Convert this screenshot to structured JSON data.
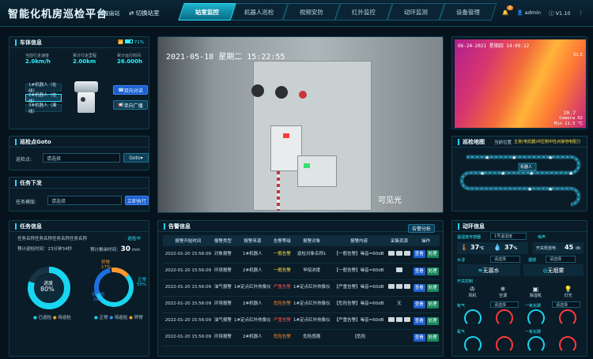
{
  "header": {
    "title": "智能化机房巡检平台",
    "site": "· 城隍庙站",
    "switch": "切换站室",
    "bell_count": "3",
    "user": "admin",
    "version": "V1.10",
    "tabs": [
      "站室监控",
      "机器人巡检",
      "视频安防",
      "红外监控",
      "动环监测",
      "设备管理"
    ]
  },
  "car": {
    "title": "车体信息",
    "battery": "71%",
    "stats": [
      {
        "label": "当前行走速度",
        "value": "2.0km/h"
      },
      {
        "label": "累计行走里程",
        "value": "2.00km"
      },
      {
        "label": "累计运行时间",
        "value": "26.000h"
      }
    ],
    "robots": [
      "1#机器人（在线）",
      "2#机器人（在线）",
      "3#机器人（离线）"
    ],
    "btn_talk": "双向对讲",
    "btn_broadcast": "单向广播"
  },
  "goto": {
    "title": "巡检点Goto",
    "label": "巡检点:",
    "placeholder": "请选择",
    "btn": "Goto"
  },
  "task": {
    "title": "任务下发",
    "label": "任务模版:",
    "placeholder": "请选择",
    "btn": "立即执行"
  },
  "taskinfo": {
    "title": "任务信息",
    "name": "任务名称任务名称任务名称任务名称",
    "status": "· 巡检中",
    "time_label": "预计巡检时间：23分钟34秒",
    "remain_label": "预计剩余时间：",
    "remain_value": "30",
    "remain_unit": "min",
    "donut1": {
      "label": "进度",
      "value": "80%",
      "percent": 80,
      "legend": [
        "已巡检",
        "待巡检"
      ]
    },
    "donut2": {
      "abnormal": "异常",
      "abnormal_v": "17%",
      "normal": "正常",
      "normal_v": "55%",
      "pending": "待巡检",
      "pending_v": "28%",
      "legend": [
        "正常",
        "待巡检",
        "异常"
      ]
    }
  },
  "video": {
    "timestamp": "2021-05-18  星期二  15:22:55",
    "caption": "可见光"
  },
  "ir": {
    "timestamp": "06-24-2021  星期四  14:09:12",
    "max": "Max 31.5 ℃",
    "cam": "Camera 02",
    "min": "Min 21.5 ℃",
    "temp1": "31.5",
    "temp2": "20.7"
  },
  "map": {
    "title": "巡检地图",
    "current_label": "当前位置",
    "current_value": "主变(电抗器)冲压侧中性点接地电阻刀",
    "robot": "机器人"
  },
  "alarm": {
    "title": "告警信息",
    "btn": "告警分析",
    "columns": [
      "报警开始时间",
      "报警类型",
      "报警来源",
      "告警等级",
      "报警对象",
      "报警内容",
      "采集资源",
      "操作"
    ],
    "rows": [
      {
        "time": "2022-01-20 15:56:09",
        "type": "对象报警",
        "src": "1#机器人",
        "lvl": "一般告警",
        "lc": "lvl1",
        "obj": "巡检对象名称1",
        "content": "【一般告警】噪音=60dB",
        "res": "icons3"
      },
      {
        "time": "2022-01-20 15:56:09",
        "type": "环境报警",
        "src": "2#机器人",
        "lvl": "一般告警",
        "lc": "lvl1",
        "obj": "甲烷浓度",
        "content": "【一般告警】噪音=60dB",
        "res": "icons1"
      },
      {
        "time": "2022-01-20 15:56:09",
        "type": "油气报警",
        "src": "1#定点红外热像仪",
        "lvl": "严重告警",
        "lc": "lvl2",
        "obj": "1#定点红外热像仪",
        "content": "【严重告警】噪音=60dB",
        "res": "icons3"
      },
      {
        "time": "2022-01-20 15:56:09",
        "type": "环境报警",
        "src": "2#机器人",
        "lvl": "危险告警",
        "lc": "lvl3",
        "obj": "1#定点红外热像仪",
        "content": "【危险告警】噪音=60dB",
        "res": "无"
      },
      {
        "time": "2022-01-20 15:56:09",
        "type": "油气报警",
        "src": "1#定点红外热像仪",
        "lvl": "严重告警",
        "lc": "lvl2",
        "obj": "1#定点红外热像仪",
        "content": "【严重告警】噪音=60dB",
        "res": "icons3"
      },
      {
        "time": "2022-01-20 15:56:09",
        "type": "环境报警",
        "src": "2#机器人",
        "lvl": "危险告警",
        "lc": "lvl3",
        "obj": "危险感器",
        "content": "【危险",
        "res": ""
      }
    ],
    "view": "查看",
    "handle": "处理"
  },
  "env": {
    "title": "动环信息",
    "sensor_label": "温湿度传感器",
    "sensor_select": "1号温湿度",
    "temp": "37",
    "temp_unit": "℃",
    "hum": "37",
    "hum_unit": "%",
    "noise_label": "噪声",
    "switch_label": "开关柜放电",
    "switch_value": "45",
    "switch_unit": "db",
    "water_label": "水浸",
    "water_select": "请选择",
    "smoke_label": "烟感",
    "smoke_select": "请选择",
    "water_status": "无漏水",
    "smoke_status": "无烟雾",
    "devices_label": "开关控制",
    "devices": [
      "风机",
      "空调",
      "除湿机",
      "灯光"
    ],
    "o2_label": "氧气",
    "co_label": "一氧化碳",
    "cl_label": "氯气",
    "extra_label": "一氧化碳",
    "select": "请选择"
  },
  "colors": {
    "accent": "#22d4ff",
    "panel": "#091c28"
  }
}
